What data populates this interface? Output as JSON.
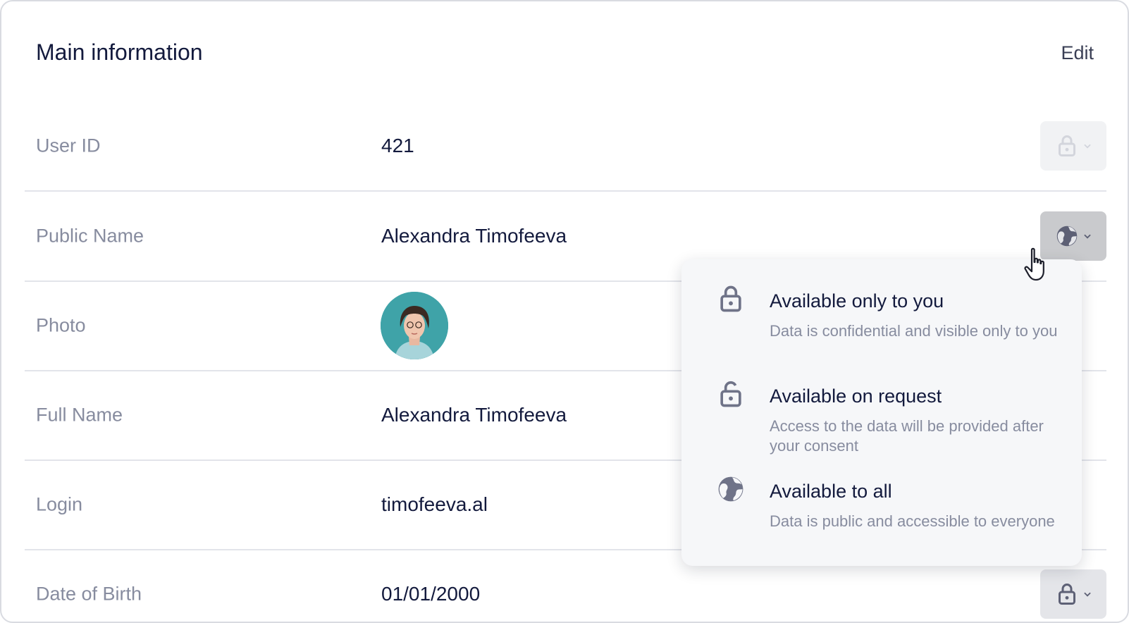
{
  "header": {
    "title": "Main information",
    "edit_label": "Edit"
  },
  "rows": [
    {
      "label": "User ID",
      "value": "421",
      "privacy_icon": "lock-icon",
      "state": "disabled"
    },
    {
      "label": "Public Name",
      "value": "Alexandra Timofeeva",
      "privacy_icon": "globe-icon",
      "state": "active"
    },
    {
      "label": "Photo",
      "value": "",
      "privacy_icon": "",
      "state": "hidden-by-menu"
    },
    {
      "label": "Full Name",
      "value": "Alexandra Timofeeva",
      "privacy_icon": "",
      "state": "hidden-by-menu"
    },
    {
      "label": "Login",
      "value": "timofeeva.al",
      "privacy_icon": "",
      "state": "hidden-by-menu"
    },
    {
      "label": "Date of Birth",
      "value": "01/01/2000",
      "privacy_icon": "lock-icon",
      "state": "normal"
    }
  ],
  "privacy_menu": {
    "options": [
      {
        "title": "Available only to you",
        "description": "Data is confidential and visible only to you",
        "icon": "lock-icon"
      },
      {
        "title": "Available on request",
        "description": "Access to the data will be provided after your consent",
        "icon": "lock-open-icon"
      },
      {
        "title": "Available to all",
        "description": "Data is public and accessible to everyone",
        "icon": "globe-icon"
      }
    ]
  },
  "colors": {
    "text_primary": "#131a3d",
    "text_secondary": "#878c9f",
    "icon": "#6f7388",
    "menu_bg": "#f6f7f9",
    "divider": "#e2e4ea"
  }
}
